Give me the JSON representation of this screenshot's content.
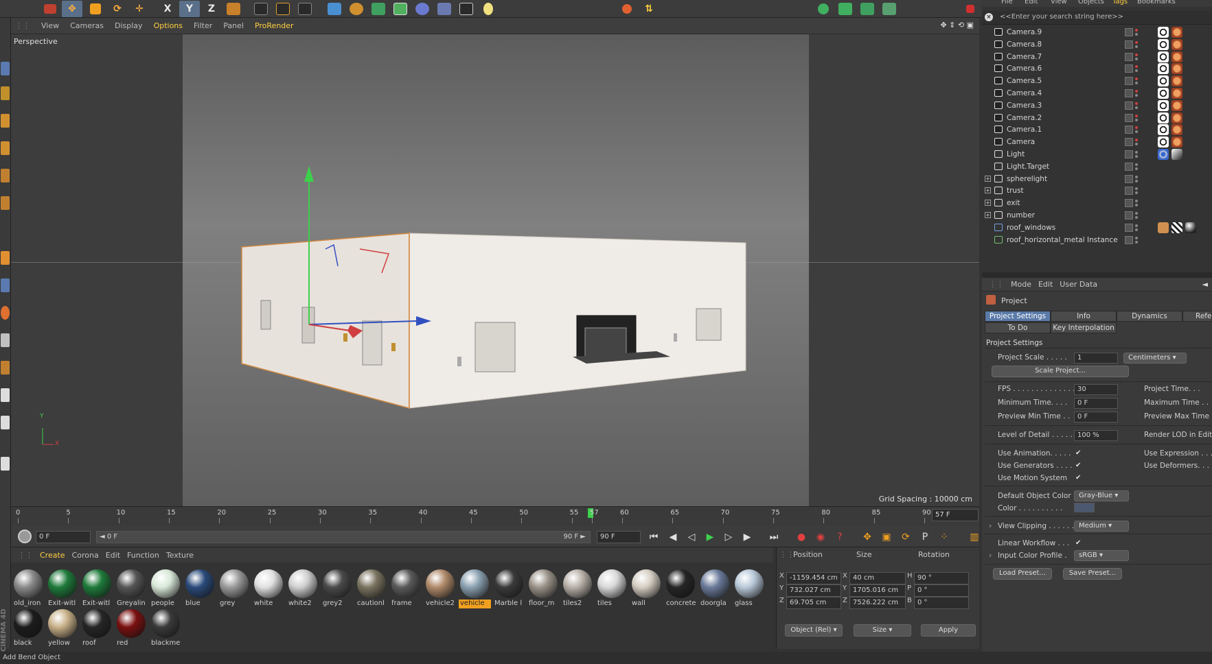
{
  "viewport": {
    "menu": [
      "View",
      "Cameras",
      "Display",
      "Options",
      "Filter",
      "Panel",
      "ProRender"
    ],
    "active_menu": "Options",
    "label": "Perspective",
    "grid_spacing": "Grid Spacing : 10000 cm",
    "axis_y": "Y",
    "axis_x": "X"
  },
  "toolbar": {
    "x_label": "X",
    "y_label": "Y",
    "z_label": "Z"
  },
  "timeline": {
    "ticks": [
      "0",
      "5",
      "10",
      "15",
      "20",
      "25",
      "30",
      "35",
      "40",
      "45",
      "50",
      "55",
      "57",
      "60",
      "65",
      "70",
      "75",
      "80",
      "85",
      "90"
    ],
    "current_frame": 57,
    "end_field": "57 F"
  },
  "transport": {
    "start_field": "0 F",
    "slider_left": "◄ 0 F",
    "slider_right": "90 F ►",
    "end_field": "90 F"
  },
  "materials": {
    "menu": [
      "Create",
      "Corona",
      "Edit",
      "Function",
      "Texture"
    ],
    "active_menu": "Create",
    "row1": [
      {
        "name": "old_iron",
        "color": "#8a8a8a"
      },
      {
        "name": "Exit-witl",
        "color": "#1e7a3a"
      },
      {
        "name": "Exit-witl",
        "color": "#1e7a3a"
      },
      {
        "name": "Greyalin",
        "color": "#555555"
      },
      {
        "name": "people",
        "color": "#d8e8d8"
      },
      {
        "name": "blue",
        "color": "#2a4a7a"
      },
      {
        "name": "grey",
        "color": "#9a9a9a"
      },
      {
        "name": "white",
        "color": "#e0e0e0"
      },
      {
        "name": "white2",
        "color": "#cfcfcf"
      },
      {
        "name": "grey2",
        "color": "#4a4a4a"
      },
      {
        "name": "cautionl",
        "color": "#7a7360"
      },
      {
        "name": "frame",
        "color": "#5a5a5a"
      },
      {
        "name": "vehicle2",
        "color": "#b08a6a"
      },
      {
        "name": "vehicle",
        "color": "#8aa0b0"
      },
      {
        "name": "Marble l",
        "color": "#3a3a3a"
      },
      {
        "name": "floor_m",
        "color": "#9a9288"
      },
      {
        "name": "tiles2",
        "color": "#b8b0a8"
      },
      {
        "name": "tiles",
        "color": "#d8d8d8"
      },
      {
        "name": "wall",
        "color": "#d4cdc2"
      },
      {
        "name": "concrete",
        "color": "#252525"
      },
      {
        "name": "doorgla",
        "color": "#6a7a9a"
      },
      {
        "name": "glass",
        "color": "#b8c8d8"
      }
    ],
    "row2": [
      {
        "name": "black",
        "color": "#1c1c1c"
      },
      {
        "name": "yellow",
        "color": "#c8b088"
      },
      {
        "name": "roof",
        "color": "#262626"
      },
      {
        "name": "red",
        "color": "#7a1010"
      },
      {
        "name": "blackme",
        "color": "#3a3a3a"
      }
    ],
    "selected": "vehicle"
  },
  "coords": {
    "headers": {
      "position": "Position",
      "size": "Size",
      "rotation": "Rotation"
    },
    "rows": [
      {
        "axis": "X",
        "pos": "-1159.454 cm",
        "saxis": "X",
        "size": "40 cm",
        "raxis": "H",
        "rot": "90 °"
      },
      {
        "axis": "Y",
        "pos": "732.027 cm",
        "saxis": "Y",
        "size": "1705.016 cm",
        "raxis": "P",
        "rot": "0 °"
      },
      {
        "axis": "Z",
        "pos": "69.705 cm",
        "saxis": "Z",
        "size": "7526.222 cm",
        "raxis": "B",
        "rot": "0 °"
      }
    ],
    "mode_dropdown": "Object (Rel)",
    "size_dropdown": "Size",
    "apply": "Apply"
  },
  "status": "Add Bend Object",
  "brand": "CINEMA 4D",
  "object_manager": {
    "menu": [
      "File",
      "Edit",
      "View",
      "Objects",
      "Tags",
      "Bookmarks"
    ],
    "active_menu": "Tags",
    "search_placeholder": "<<Enter your search string here>>",
    "objects": [
      {
        "name": "Camera.9",
        "kind": "camera"
      },
      {
        "name": "Camera.8",
        "kind": "camera"
      },
      {
        "name": "Camera.7",
        "kind": "camera"
      },
      {
        "name": "Camera.6",
        "kind": "camera"
      },
      {
        "name": "Camera.5",
        "kind": "camera"
      },
      {
        "name": "Camera.4",
        "kind": "camera"
      },
      {
        "name": "Camera.3",
        "kind": "camera"
      },
      {
        "name": "Camera.2",
        "kind": "camera"
      },
      {
        "name": "Camera.1",
        "kind": "camera"
      },
      {
        "name": "Camera",
        "kind": "camera"
      },
      {
        "name": "Light",
        "kind": "light"
      },
      {
        "name": "Light.Target",
        "kind": "null"
      },
      {
        "name": "spherelight",
        "kind": "null"
      },
      {
        "name": "trust",
        "kind": "null"
      },
      {
        "name": "exit",
        "kind": "null"
      },
      {
        "name": "number",
        "kind": "null"
      },
      {
        "name": "roof_windows",
        "kind": "poly"
      },
      {
        "name": "roof_horizontal_metal Instance",
        "kind": "instance"
      }
    ]
  },
  "attributes": {
    "menu": [
      "Mode",
      "Edit",
      "User Data"
    ],
    "object_title": "Project",
    "tabs_row1": [
      "Project Settings",
      "Info",
      "Dynamics",
      "Referencing"
    ],
    "tabs_row2": [
      "To Do",
      "Key Interpolation"
    ],
    "section": "Project Settings",
    "project_scale_label": "Project Scale . . . . .",
    "project_scale_value": "1",
    "project_scale_unit": "Centimeters",
    "scale_project_btn": "Scale Project...",
    "fps_label": "FPS . . . . . . . . . . . . . .",
    "fps_value": "30",
    "project_time_label": "Project Time. . .",
    "min_time_label": "Minimum Time. . . .",
    "min_time_value": "0 F",
    "max_time_label": "Maximum Time . .",
    "preview_min_label": "Preview Min Time . .",
    "preview_min_value": "0 F",
    "preview_max_label": "Preview Max Time .",
    "lod_label": "Level of Detail . . . . .",
    "lod_value": "100 %",
    "render_lod_label": "Render LOD in Editor",
    "use_animation": "Use Animation. . . . .",
    "use_expression": "Use Expression . . .",
    "use_generators": "Use Generators . . . .",
    "use_deformers": "Use Deformers. . . .",
    "use_motion": "Use Motion System",
    "default_color_label": "Default Object Color",
    "default_color_value": "Gray-Blue",
    "color_label": "Color . . . . . . . . . .",
    "view_clipping_label": "View Clipping . . . . . .",
    "view_clipping_value": "Medium",
    "linear_workflow_label": "Linear Workflow . . .",
    "input_profile_label": "Input Color Profile .",
    "input_profile_value": "sRGB",
    "load_preset": "Load Preset...",
    "save_preset": "Save Preset..."
  },
  "colors": {
    "accent": "#ffcf40",
    "selection": "#5a7aa8",
    "axis_y": "#3dd04b",
    "axis_x": "#d04040",
    "axis_z": "#3050c0"
  }
}
